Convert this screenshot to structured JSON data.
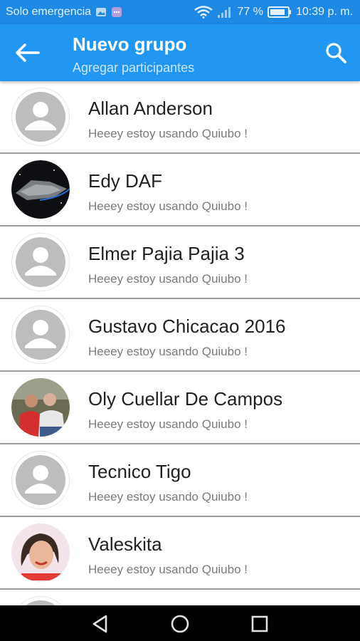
{
  "status_bar": {
    "carrier": "Solo emergencia",
    "battery": "77 %",
    "time": "10:39 p. m."
  },
  "app_bar": {
    "title": "Nuevo grupo",
    "subtitle": "Agregar participantes"
  },
  "contacts": [
    {
      "name": "Allan Anderson",
      "status": "Heeey estoy usando Quiubo !",
      "avatar": "default"
    },
    {
      "name": "Edy DAF",
      "status": "Heeey estoy usando Quiubo !",
      "avatar": "photo-space"
    },
    {
      "name": "Elmer Pajia Pajia 3",
      "status": "Heeey estoy usando Quiubo !",
      "avatar": "default"
    },
    {
      "name": "Gustavo Chicacao 2016",
      "status": "Heeey estoy usando Quiubo !",
      "avatar": "default"
    },
    {
      "name": "Oly Cuellar De Campos",
      "status": "Heeey estoy usando Quiubo !",
      "avatar": "photo-couple"
    },
    {
      "name": "Tecnico Tigo",
      "status": "Heeey estoy usando Quiubo !",
      "avatar": "default"
    },
    {
      "name": "Valeskita",
      "status": "Heeey estoy usando Quiubo !",
      "avatar": "photo-woman"
    },
    {
      "name": "",
      "status": "",
      "avatar": "default"
    }
  ],
  "colors": {
    "status_bar": "#1e88e5",
    "app_bar": "#2196f3",
    "divider": "#9e9e9e",
    "navbar": "#000000"
  }
}
